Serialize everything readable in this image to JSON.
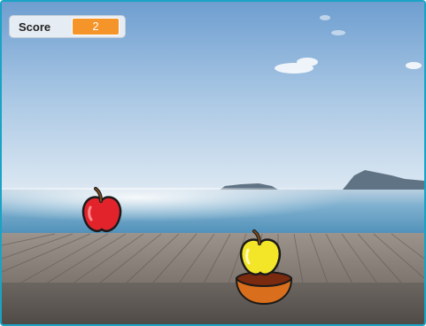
{
  "monitor": {
    "label": "Score",
    "value": "2"
  },
  "sprites": {
    "falling_apple": "red-apple-icon",
    "caught_apple": "yellow-apple-icon",
    "catcher": "bowl-icon"
  },
  "colors": {
    "stage_border": "#1aa3c4",
    "monitor_value_bg": "#f59428",
    "red_apple": "#e2232b",
    "yellow_apple": "#f3e629",
    "bowl": "#d96f1c"
  }
}
